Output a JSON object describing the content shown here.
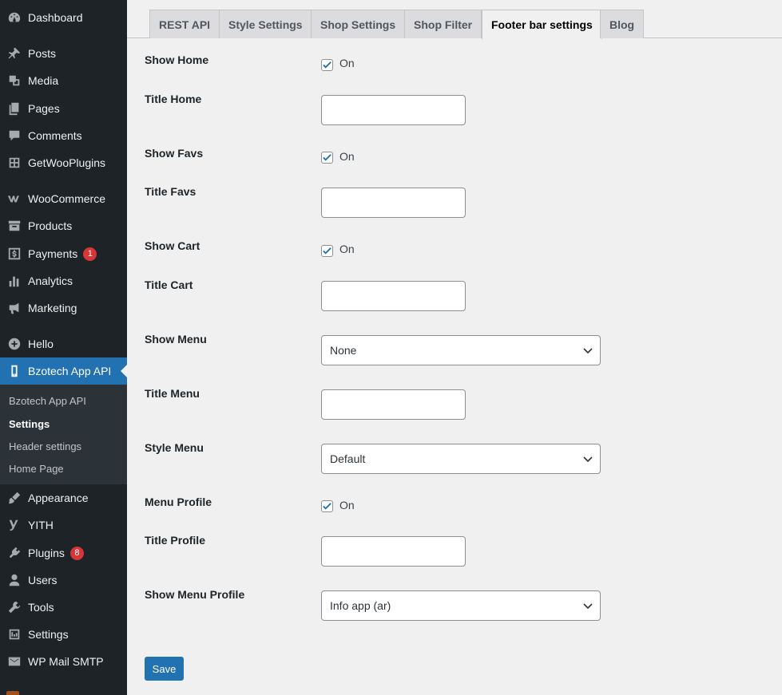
{
  "sidebar": {
    "items": [
      {
        "label": "Dashboard",
        "icon": "dashboard-icon"
      },
      {
        "label": "Posts",
        "icon": "pin-icon"
      },
      {
        "label": "Media",
        "icon": "media-icon"
      },
      {
        "label": "Pages",
        "icon": "pages-icon"
      },
      {
        "label": "Comments",
        "icon": "comments-icon"
      },
      {
        "label": "GetWooPlugins",
        "icon": "plugins-grid-icon"
      },
      {
        "label": "WooCommerce",
        "icon": "woo-icon"
      },
      {
        "label": "Products",
        "icon": "archive-icon"
      },
      {
        "label": "Payments",
        "icon": "dollar-icon",
        "badge": "1"
      },
      {
        "label": "Analytics",
        "icon": "bar-chart-icon"
      },
      {
        "label": "Marketing",
        "icon": "megaphone-icon"
      },
      {
        "label": "Hello",
        "icon": "plus-circle-icon"
      },
      {
        "label": "Bzotech App API",
        "icon": "phone-icon"
      },
      {
        "label": "Appearance",
        "icon": "brush-icon"
      },
      {
        "label": "YITH",
        "icon": "yith-icon"
      },
      {
        "label": "Plugins",
        "icon": "plug-icon",
        "badge": "8"
      },
      {
        "label": "Users",
        "icon": "user-icon"
      },
      {
        "label": "Tools",
        "icon": "wrench-icon"
      },
      {
        "label": "Settings",
        "icon": "settings-icon"
      },
      {
        "label": "WP Mail SMTP",
        "icon": "mail-icon"
      }
    ],
    "submenu": [
      {
        "label": "Bzotech App API"
      },
      {
        "label": "Settings"
      },
      {
        "label": "Header settings"
      },
      {
        "label": "Home Page"
      }
    ]
  },
  "tabs": [
    {
      "label": "REST API"
    },
    {
      "label": "Style Settings"
    },
    {
      "label": "Shop Settings"
    },
    {
      "label": "Shop Filter"
    },
    {
      "label": "Footer bar settings"
    },
    {
      "label": "Blog"
    }
  ],
  "form": {
    "show_home": {
      "label": "Show Home",
      "checked": true,
      "text": "On"
    },
    "title_home": {
      "label": "Title Home",
      "value": ""
    },
    "show_favs": {
      "label": "Show Favs",
      "checked": true,
      "text": "On"
    },
    "title_favs": {
      "label": "Title Favs",
      "value": ""
    },
    "show_cart": {
      "label": "Show Cart",
      "checked": true,
      "text": "On"
    },
    "title_cart": {
      "label": "Title Cart",
      "value": ""
    },
    "show_menu": {
      "label": "Show Menu",
      "selected": "None"
    },
    "title_menu": {
      "label": "Title Menu",
      "value": ""
    },
    "style_menu": {
      "label": "Style Menu",
      "selected": "Default"
    },
    "menu_profile": {
      "label": "Menu Profile",
      "checked": true,
      "text": "On"
    },
    "title_profile": {
      "label": "Title Profile",
      "value": ""
    },
    "show_menu_profile": {
      "label": "Show Menu Profile",
      "selected": "Info app (ar)"
    }
  },
  "save_label": "Save",
  "colors": {
    "accent": "#2271b1",
    "sidebar_bg": "#1d2327",
    "badge": "#d63638"
  }
}
